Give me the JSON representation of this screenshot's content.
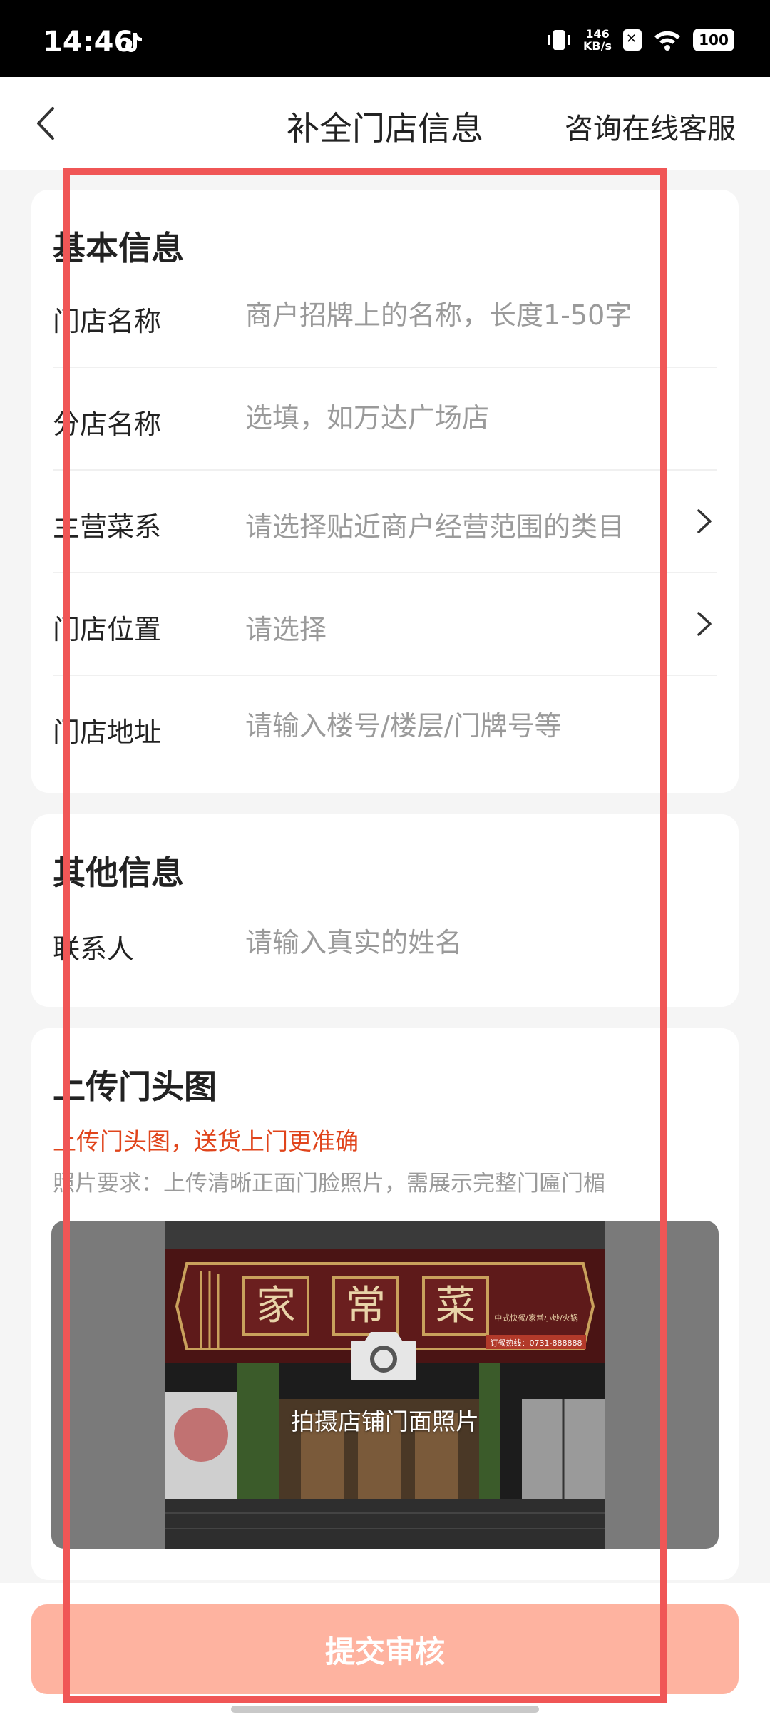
{
  "status_bar": {
    "time": "14:46",
    "net_speed_value": "146",
    "net_speed_unit": "KB/s",
    "battery": "100"
  },
  "nav": {
    "title": "补全门店信息",
    "service_link": "咨询在线客服"
  },
  "basic_info": {
    "title": "基本信息",
    "rows": [
      {
        "label": "门店名称",
        "placeholder": "商户招牌上的名称，长度1-50字",
        "type": "input"
      },
      {
        "label": "分店名称",
        "placeholder": "选填，如万达广场店",
        "type": "input"
      },
      {
        "label": "主营菜系",
        "placeholder": "请选择贴近商户经营范围的类目",
        "type": "select"
      },
      {
        "label": "门店位置",
        "placeholder": "请选择",
        "type": "select"
      },
      {
        "label": "门店地址",
        "placeholder": "请输入楼号/楼层/门牌号等",
        "type": "input"
      }
    ]
  },
  "other_info": {
    "title": "其他信息",
    "rows": [
      {
        "label": "联系人",
        "placeholder": "请输入真实的姓名",
        "type": "input"
      }
    ]
  },
  "upload": {
    "title": "上传门头图",
    "note_red": "上传门头图，送货上门更准确",
    "note_gray": "照片要求：上传清晰正面门脸照片，需展示完整门匾门楣",
    "caption": "拍摄店铺门面照片",
    "sign_chars": [
      "家",
      "常",
      "菜"
    ],
    "sign_small": "中式快餐/家常小炒/火锅",
    "sign_phone": "订餐热线：0731-888888"
  },
  "submit_label": "提交审核",
  "colors": {
    "accent": "#e0441b",
    "submit_disabled": "#feb3a0",
    "highlight": "#f05656"
  }
}
